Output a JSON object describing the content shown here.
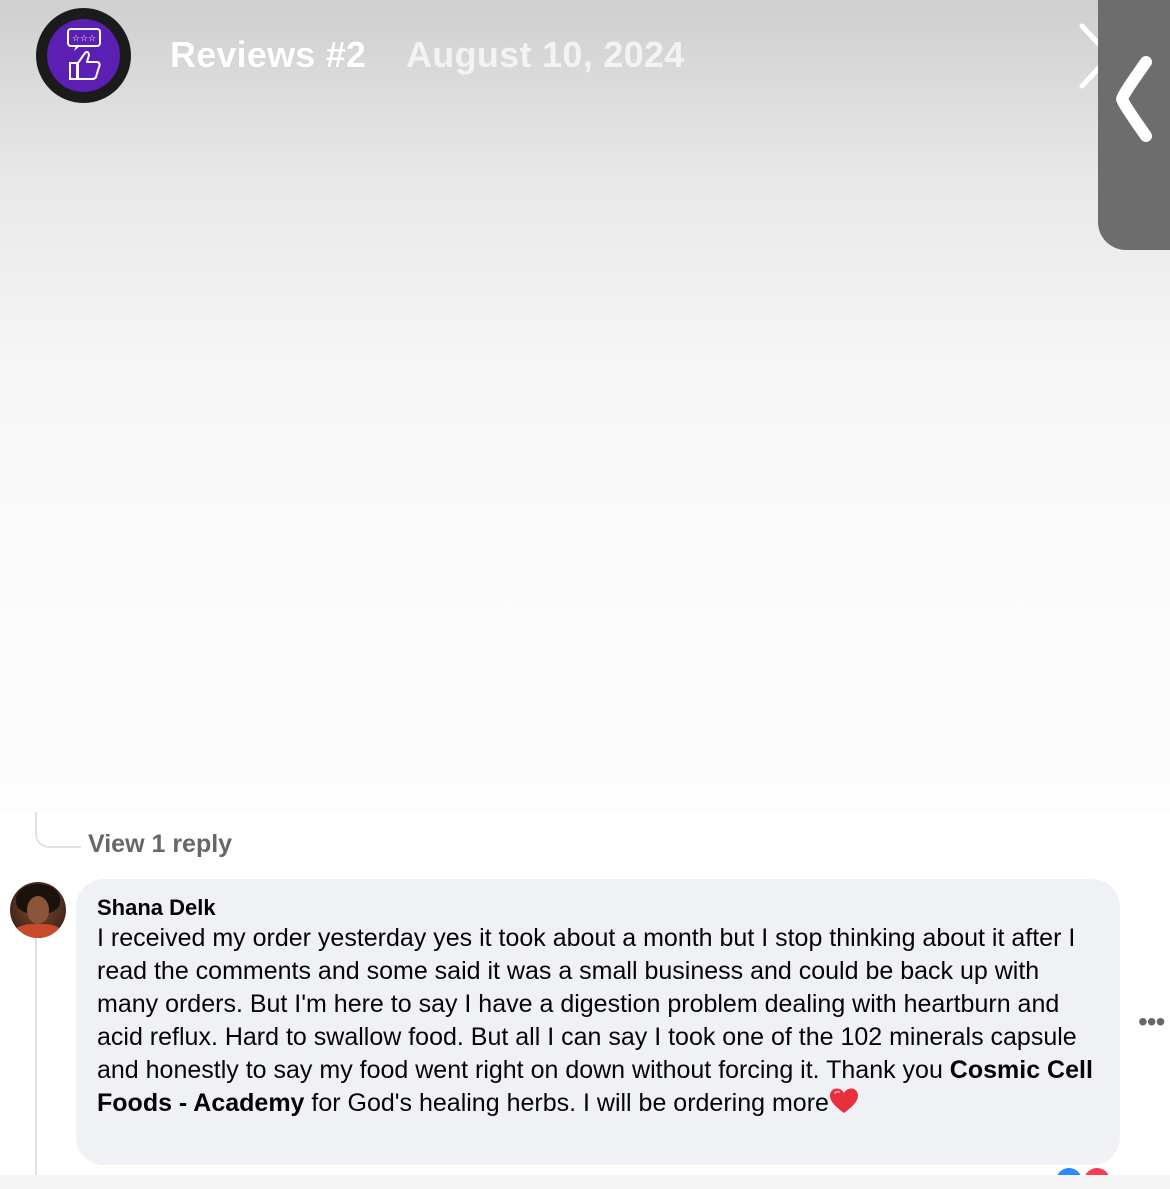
{
  "header": {
    "title": "Reviews #2",
    "date": "August 10, 2024",
    "avatar_icon": "reviews-thumbs-up-icon",
    "accent_color": "#5b1fb3"
  },
  "thread": {
    "view_reply_label": "View 1 reply"
  },
  "comment": {
    "author": "Shana Delk",
    "text_before": "I received my order yesterday yes it took about a month but I stop thinking about it after I read the comments and some said it was a small business and could be back up with many orders. But I'm here to say I have a digestion problem dealing with heartburn and acid reflux. Hard to swallow food. But all I can say I took one of the 102 minerals capsule and honestly to say my food went right on down without forcing it. Thank you ",
    "mention": "Cosmic Cell Foods - Academy",
    "text_after": " for God's healing herbs. I will be ordering more",
    "emoji": "heart-icon",
    "bubble_color": "#eff1f5"
  },
  "actions": {
    "more_label": "•••"
  }
}
